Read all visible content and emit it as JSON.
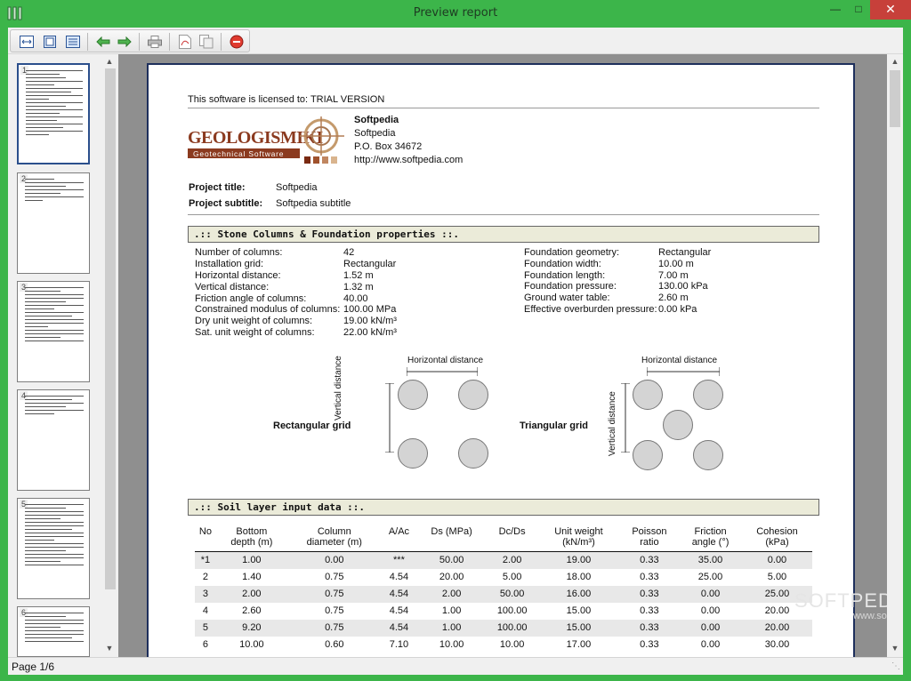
{
  "window": {
    "title": "Preview report"
  },
  "toolbar": {
    "buttons": [
      {
        "name": "fit-page-button",
        "icon": "fit-page-icon"
      },
      {
        "name": "fit-width-button",
        "icon": "fit-width-icon"
      },
      {
        "name": "two-page-button",
        "icon": "page-view-icon"
      },
      {
        "name": "previous-page-button",
        "icon": "arrow-left-icon"
      },
      {
        "name": "next-page-button",
        "icon": "arrow-right-icon"
      },
      {
        "name": "print-button",
        "icon": "printer-icon"
      },
      {
        "name": "export-pdf-button",
        "icon": "pdf-icon"
      },
      {
        "name": "export-copy-button",
        "icon": "copy-icon"
      },
      {
        "name": "close-preview-button",
        "icon": "stop-icon"
      }
    ]
  },
  "thumbnails": [
    {
      "num": "1",
      "selected": true
    },
    {
      "num": "2",
      "selected": false
    },
    {
      "num": "3",
      "selected": false
    },
    {
      "num": "4",
      "selected": false
    },
    {
      "num": "5",
      "selected": false
    },
    {
      "num": "6",
      "selected": false
    }
  ],
  "status": {
    "page": "Page 1/6"
  },
  "report": {
    "license": "This software is licensed to: TRIAL VERSION",
    "logo": {
      "text": "GEOLOGISMIKI",
      "sub": "Geotechnical Software"
    },
    "company": {
      "name": "Softpedia",
      "line1": "Softpedia",
      "line2": "P.O. Box 34672",
      "line3": "http://www.softpedia.com"
    },
    "project": {
      "title_label": "Project title:",
      "title_value": "Softpedia",
      "subtitle_label": "Project subtitle:",
      "subtitle_value": "Softpedia subtitle"
    },
    "section1": ".:: Stone Columns & Foundation properties ::.",
    "left_props": [
      {
        "label": "Number of columns:",
        "value": "42"
      },
      {
        "label": "Installation grid:",
        "value": "Rectangular"
      },
      {
        "label": "Horizontal distance:",
        "value": "1.52 m"
      },
      {
        "label": "Vertical distance:",
        "value": "1.32 m"
      },
      {
        "label": "Friction angle of columns:",
        "value": "40.00"
      },
      {
        "label": "Constrained modulus of columns:",
        "value": "100.00 MPa"
      },
      {
        "label": "Dry unit weight of columns:",
        "value": "19.00 kN/m³"
      },
      {
        "label": "Sat. unit weight of columns:",
        "value": "22.00 kN/m³"
      }
    ],
    "right_props": [
      {
        "label": "Foundation geometry:",
        "value": "Rectangular"
      },
      {
        "label": "Foundation width:",
        "value": "10.00 m"
      },
      {
        "label": "Foundation length:",
        "value": "7.00 m"
      },
      {
        "label": "Foundation pressure:",
        "value": "130.00 kPa"
      },
      {
        "label": "Ground water table:",
        "value": "2.60 m"
      },
      {
        "label": "Effective overburden pressure:",
        "value": "0.00 kPa"
      }
    ],
    "diagram": {
      "rect_label": "Rectangular grid",
      "tri_label": "Triangular grid",
      "horizontal": "Horizontal distance",
      "vertical": "Vertical distance"
    },
    "section2": ".:: Soil layer input data ::.",
    "soil_headers": [
      "No",
      "Bottom\ndepth (m)",
      "Column\ndiameter (m)",
      "A/Ac",
      "Ds (MPa)",
      "Dc/Ds",
      "Unit weight\n(kN/m³)",
      "Poisson\nratio",
      "Friction\nangle (°)",
      "Cohesion\n(kPa)"
    ],
    "soil_rows": [
      [
        "*1",
        "1.00",
        "0.00",
        "***",
        "50.00",
        "2.00",
        "19.00",
        "0.33",
        "35.00",
        "0.00"
      ],
      [
        "2",
        "1.40",
        "0.75",
        "4.54",
        "20.00",
        "5.00",
        "18.00",
        "0.33",
        "25.00",
        "5.00"
      ],
      [
        "3",
        "2.00",
        "0.75",
        "4.54",
        "2.00",
        "50.00",
        "16.00",
        "0.33",
        "0.00",
        "25.00"
      ],
      [
        "4",
        "2.60",
        "0.75",
        "4.54",
        "1.00",
        "100.00",
        "15.00",
        "0.33",
        "0.00",
        "20.00"
      ],
      [
        "5",
        "9.20",
        "0.75",
        "4.54",
        "1.00",
        "100.00",
        "15.00",
        "0.33",
        "0.00",
        "20.00"
      ],
      [
        "6",
        "10.00",
        "0.60",
        "7.10",
        "10.00",
        "10.00",
        "17.00",
        "0.33",
        "0.00",
        "30.00"
      ]
    ],
    "watermark": "SOFTPEDIA",
    "watermark_sub": "www.softpedia.com"
  },
  "colors": {
    "titlebar": "#3cb54a",
    "close": "#c7403a",
    "section_bg": "#ebebd9",
    "page_border": "#1e2f5c"
  }
}
